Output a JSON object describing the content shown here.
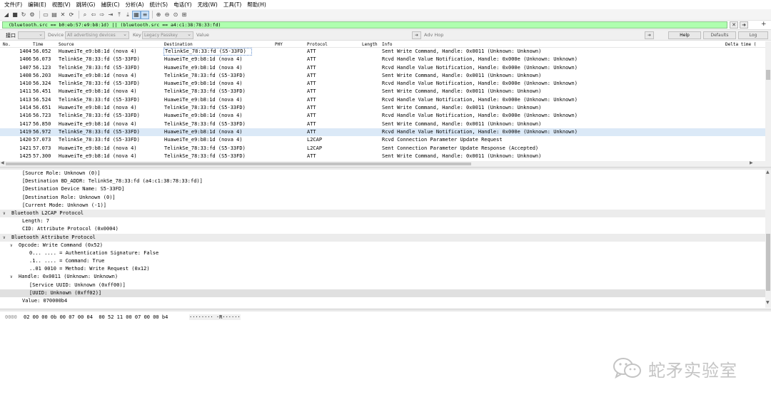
{
  "menu": [
    "文件(F)",
    "编辑(E)",
    "视图(V)",
    "跳转(G)",
    "捕获(C)",
    "分析(A)",
    "统计(S)",
    "电话(Y)",
    "无线(W)",
    "工具(T)",
    "帮助(H)"
  ],
  "toolbar_icons": [
    "shark-fin-start-icon",
    "stop-icon",
    "restart-icon",
    "options-gear-icon",
    "open-folder-icon",
    "save-icon",
    "close-file-icon",
    "reload-icon",
    "find-icon",
    "back-arrow-icon",
    "forward-arrow-icon",
    "goto-packet-icon",
    "first-packet-icon",
    "last-packet-icon",
    "autoscroll-icon",
    "colorize-icon",
    "zoom-in-icon",
    "zoom-out-icon",
    "zoom-reset-icon",
    "resize-columns-icon"
  ],
  "filter": {
    "value": "(bluetooth.src == b0:eb:57:e9:b8:1d) || (bluetooth.src == a4:c1:38:78:33:fd)"
  },
  "iface": {
    "label": "接口",
    "device_label": "Device",
    "device_value": "All advertising devices",
    "key_label": "Key",
    "key_value": "Legacy Passkey",
    "value_label": "Value",
    "adv_hop_label": "Adv Hop",
    "help_label": "Help",
    "defaults_label": "Defaults",
    "log_label": "Log"
  },
  "packets": {
    "columns": [
      "No.",
      "Time",
      "Source",
      "Destination",
      "PHY",
      "Protocol",
      "Length",
      "Info",
      "Delta time ("
    ],
    "rows": [
      {
        "no": "1404",
        "time": "56.052",
        "src": "HuaweiTe_e9:b8:1d (nova 4)",
        "dst": "TelinkSe_78:33:fd (S5-33FD)",
        "proto": "ATT",
        "info": "Sent Write Command, Handle: 0x0011 (Unknown: Unknown)"
      },
      {
        "no": "1406",
        "time": "56.073",
        "src": "TelinkSe_78:33:fd (S5-33FD)",
        "dst": "HuaweiTe_e9:b8:1d (nova 4)",
        "proto": "ATT",
        "info": "Rcvd Handle Value Notification, Handle: 0x000e (Unknown: Unknown)"
      },
      {
        "no": "1407",
        "time": "56.123",
        "src": "TelinkSe_78:33:fd (S5-33FD)",
        "dst": "HuaweiTe_e9:b8:1d (nova 4)",
        "proto": "ATT",
        "info": "Rcvd Handle Value Notification, Handle: 0x000e (Unknown: Unknown)"
      },
      {
        "no": "1408",
        "time": "56.203",
        "src": "HuaweiTe_e9:b8:1d (nova 4)",
        "dst": "TelinkSe_78:33:fd (S5-33FD)",
        "proto": "ATT",
        "info": "Sent Write Command, Handle: 0x0011 (Unknown: Unknown)"
      },
      {
        "no": "1410",
        "time": "56.324",
        "src": "TelinkSe_78:33:fd (S5-33FD)",
        "dst": "HuaweiTe_e9:b8:1d (nova 4)",
        "proto": "ATT",
        "info": "Rcvd Handle Value Notification, Handle: 0x000e (Unknown: Unknown)"
      },
      {
        "no": "1411",
        "time": "56.451",
        "src": "HuaweiTe_e9:b8:1d (nova 4)",
        "dst": "TelinkSe_78:33:fd (S5-33FD)",
        "proto": "ATT",
        "info": "Sent Write Command, Handle: 0x0011 (Unknown: Unknown)"
      },
      {
        "no": "1413",
        "time": "56.524",
        "src": "TelinkSe_78:33:fd (S5-33FD)",
        "dst": "HuaweiTe_e9:b8:1d (nova 4)",
        "proto": "ATT",
        "info": "Rcvd Handle Value Notification, Handle: 0x000e (Unknown: Unknown)"
      },
      {
        "no": "1414",
        "time": "56.651",
        "src": "HuaweiTe_e9:b8:1d (nova 4)",
        "dst": "TelinkSe_78:33:fd (S5-33FD)",
        "proto": "ATT",
        "info": "Sent Write Command, Handle: 0x0011 (Unknown: Unknown)"
      },
      {
        "no": "1416",
        "time": "56.723",
        "src": "TelinkSe_78:33:fd (S5-33FD)",
        "dst": "HuaweiTe_e9:b8:1d (nova 4)",
        "proto": "ATT",
        "info": "Rcvd Handle Value Notification, Handle: 0x000e (Unknown: Unknown)"
      },
      {
        "no": "1417",
        "time": "56.850",
        "src": "HuaweiTe_e9:b8:1d (nova 4)",
        "dst": "TelinkSe_78:33:fd (S5-33FD)",
        "proto": "ATT",
        "info": "Sent Write Command, Handle: 0x0011 (Unknown: Unknown)"
      },
      {
        "no": "1419",
        "time": "56.972",
        "src": "TelinkSe_78:33:fd (S5-33FD)",
        "dst": "HuaweiTe_e9:b8:1d (nova 4)",
        "proto": "ATT",
        "info": "Rcvd Handle Value Notification, Handle: 0x000e (Unknown: Unknown)"
      },
      {
        "no": "1420",
        "time": "57.073",
        "src": "TelinkSe_78:33:fd (S5-33FD)",
        "dst": "HuaweiTe_e9:b8:1d (nova 4)",
        "proto": "L2CAP",
        "info": "Rcvd Connection Parameter Update Request"
      },
      {
        "no": "1421",
        "time": "57.073",
        "src": "HuaweiTe_e9:b8:1d (nova 4)",
        "dst": "TelinkSe_78:33:fd (S5-33FD)",
        "proto": "L2CAP",
        "info": "Sent Connection Parameter Update Response (Accepted)"
      },
      {
        "no": "1425",
        "time": "57.300",
        "src": "HuaweiTe_e9:b8:1d (nova 4)",
        "dst": "TelinkSe_78:33:fd (S5-33FD)",
        "proto": "ATT",
        "info": "Sent Write Command, Handle: 0x0011 (Unknown: Unknown)"
      }
    ]
  },
  "details": [
    {
      "indent": 2,
      "twisty": "",
      "text": "[Source Role: Unknown (0)]",
      "style": ""
    },
    {
      "indent": 2,
      "twisty": "",
      "text": "[Destination BD_ADDR: TelinkSe_78:33:fd (a4:c1:38:78:33:fd)]",
      "style": ""
    },
    {
      "indent": 2,
      "twisty": "",
      "text": "[Destination Device Name: S5-33FD]",
      "style": ""
    },
    {
      "indent": 2,
      "twisty": "",
      "text": "[Destination Role: Unknown (0)]",
      "style": ""
    },
    {
      "indent": 2,
      "twisty": "",
      "text": "[Current Mode: Unknown (-1)]",
      "style": ""
    },
    {
      "indent": 0,
      "twisty": "∨",
      "text": "Bluetooth L2CAP Protocol",
      "style": "sec"
    },
    {
      "indent": 2,
      "twisty": "",
      "text": "Length: 7",
      "style": ""
    },
    {
      "indent": 2,
      "twisty": "",
      "text": "CID: Attribute Protocol (0x0004)",
      "style": ""
    },
    {
      "indent": 0,
      "twisty": "∨",
      "text": "Bluetooth Attribute Protocol",
      "style": "sec"
    },
    {
      "indent": 1,
      "twisty": "∨",
      "text": "Opcode: Write Command (0x52)",
      "style": ""
    },
    {
      "indent": 3,
      "twisty": "",
      "text": "0... .... = Authentication Signature: False",
      "style": ""
    },
    {
      "indent": 3,
      "twisty": "",
      "text": ".1.. .... = Command: True",
      "style": ""
    },
    {
      "indent": 3,
      "twisty": "",
      "text": "..01 0010 = Method: Write Request (0x12)",
      "style": ""
    },
    {
      "indent": 1,
      "twisty": "∨",
      "text": "Handle: 0x0011 (Unknown: Unknown)",
      "style": ""
    },
    {
      "indent": 3,
      "twisty": "",
      "text": "[Service UUID: Unknown (0xff00)]",
      "style": ""
    },
    {
      "indent": 3,
      "twisty": "",
      "text": "[UUID: Unknown (0xff02)]",
      "style": "hl"
    },
    {
      "indent": 2,
      "twisty": "",
      "text": "Value: 070000b4",
      "style": ""
    }
  ],
  "bytes": {
    "offset": "0000",
    "hex": "02 00 00 0b 00 07 00 04  00 52 11 00 07 00 00 b4",
    "ascii": "········ ·R······"
  },
  "watermark": {
    "text": "蛇矛实验室"
  }
}
